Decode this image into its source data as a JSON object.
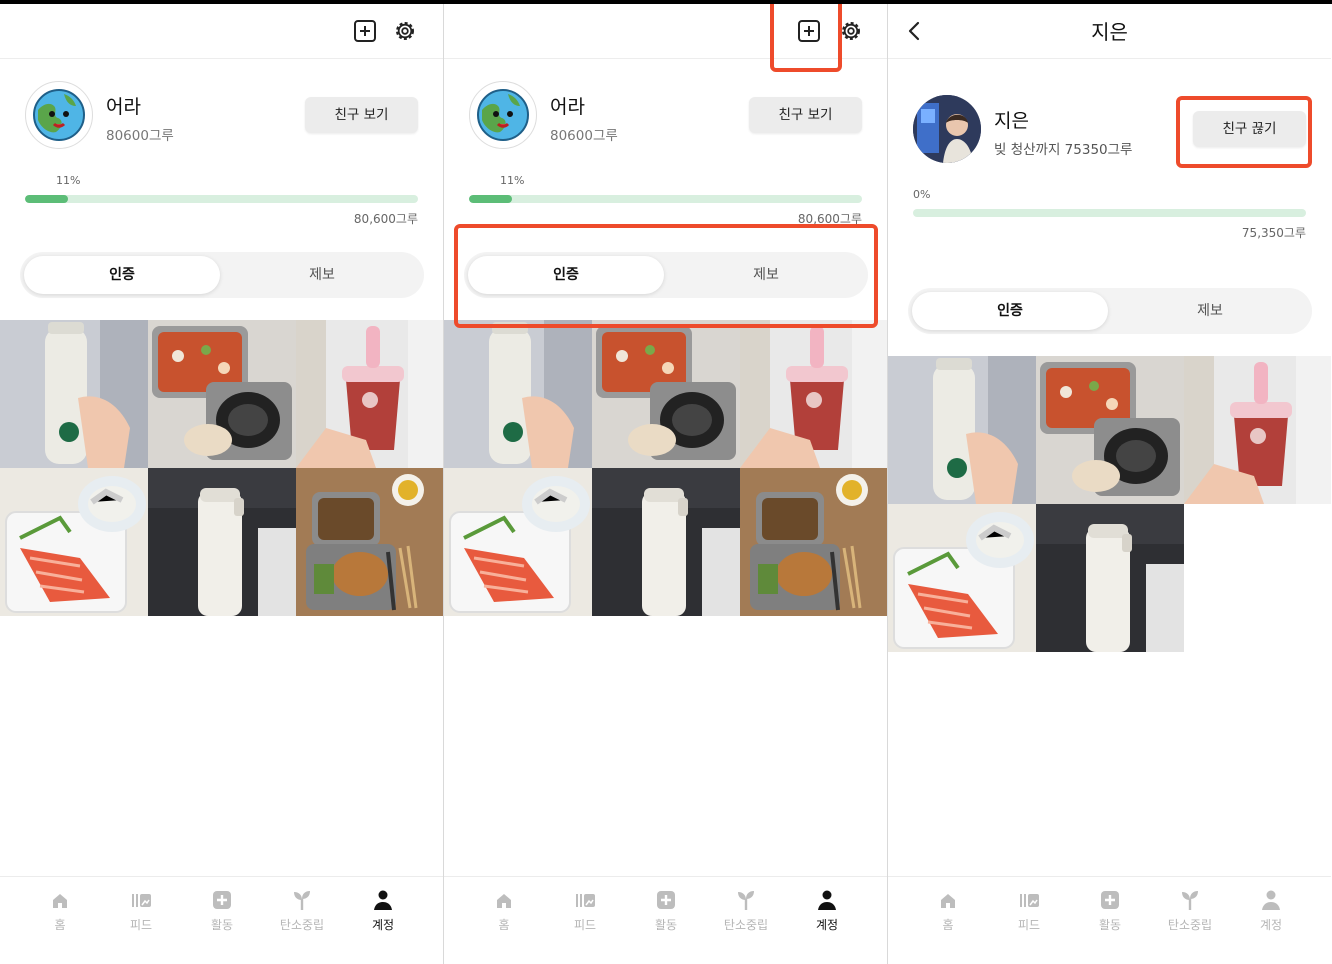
{
  "panels": [
    {
      "user": {
        "name": "어라",
        "sub": "80600그루",
        "friend_btn": "친구 보기"
      },
      "progress": {
        "percent_label": "11%",
        "fill_fraction": 0.11,
        "total": "80,600그루"
      },
      "tabs": {
        "active": "인증",
        "inactive": "제보"
      },
      "nav": {
        "home": "홈",
        "feed": "피드",
        "activity": "활동",
        "carbon": "탄소중립",
        "account": "계정"
      }
    },
    {
      "user": {
        "name": "어라",
        "sub": "80600그루",
        "friend_btn": "친구 보기"
      },
      "progress": {
        "percent_label": "11%",
        "fill_fraction": 0.11,
        "total": "80,600그루"
      },
      "tabs": {
        "active": "인증",
        "inactive": "제보"
      },
      "nav": {
        "home": "홈",
        "feed": "피드",
        "activity": "활동",
        "carbon": "탄소중립",
        "account": "계정"
      }
    },
    {
      "title": "지은",
      "user": {
        "name": "지은",
        "sub": "빚 청산까지 75350그루",
        "friend_btn": "친구 끊기"
      },
      "progress": {
        "percent_label": "0%",
        "fill_fraction": 0,
        "total": "75,350그루"
      },
      "tabs": {
        "active": "인증",
        "inactive": "제보"
      },
      "nav": {
        "home": "홈",
        "feed": "피드",
        "activity": "활동",
        "carbon": "탄소중립",
        "account": "계정"
      }
    }
  ],
  "colors": {
    "accent_green": "#5cbd77",
    "highlight_red": "#ee4b2b",
    "active_nav": "#111111",
    "inactive_nav": "#b5b5b5"
  },
  "icons": [
    "plus-square-icon",
    "gear-icon",
    "back-chevron-icon",
    "home-icon",
    "feed-icon",
    "activity-plus-icon",
    "sprout-icon",
    "person-icon"
  ]
}
